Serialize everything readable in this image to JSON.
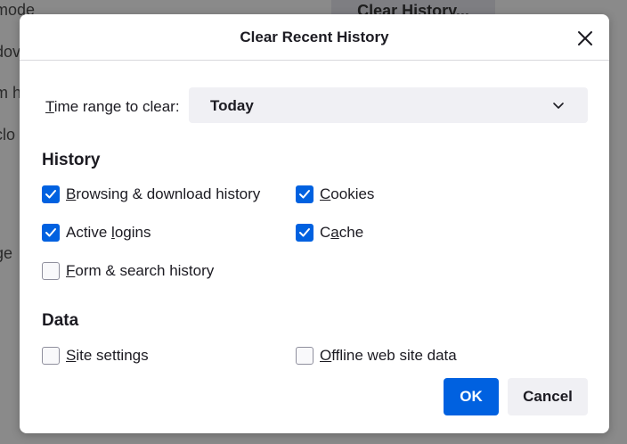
{
  "background": {
    "texts": [
      "mode",
      "dov",
      "m h",
      "clo",
      "ge"
    ],
    "button_label": "Clear History..."
  },
  "dialog": {
    "title": "Clear Recent History",
    "close_icon": "close-icon"
  },
  "time_range": {
    "label_accesskey": "T",
    "label_rest": "ime range to clear:",
    "selected": "Today",
    "chevron_icon": "chevron-down-icon"
  },
  "history": {
    "heading": "History",
    "items": [
      {
        "accesskey": "B",
        "rest": "rowsing & download history",
        "checked": true
      },
      {
        "accesskey": "C",
        "rest": "ookies",
        "checked": true
      },
      {
        "pre": "Active ",
        "accesskey": "l",
        "rest": "ogins",
        "checked": true
      },
      {
        "pre": "C",
        "accesskey": "a",
        "rest": "che",
        "checked": true
      },
      {
        "accesskey": "F",
        "rest": "orm & search history",
        "checked": false
      }
    ]
  },
  "data": {
    "heading": "Data",
    "items": [
      {
        "accesskey": "S",
        "rest": "ite settings",
        "checked": false
      },
      {
        "accesskey": "O",
        "rest": "ffline web site data",
        "checked": false
      }
    ]
  },
  "buttons": {
    "ok": "OK",
    "cancel": "Cancel"
  },
  "colors": {
    "accent": "#0061e0",
    "overlay": "#8a8a8a"
  }
}
